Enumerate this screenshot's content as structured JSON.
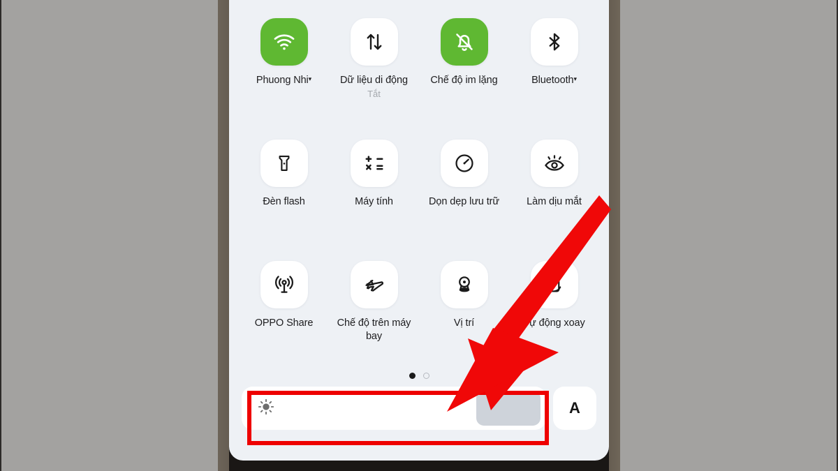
{
  "device": {
    "name": "phone-quick-settings",
    "panel_background": "#eef1f5",
    "accent_on_color": "#5fb832",
    "highlight_color": "#ee0000"
  },
  "quick_settings": {
    "tiles": [
      {
        "label": "Phuong Nhi",
        "caret": "▾",
        "sub": "",
        "state": "on",
        "icon": "wifi-icon"
      },
      {
        "label": "Dữ liệu di động",
        "caret": "",
        "sub": "Tắt",
        "state": "off",
        "icon": "mobile-data-icon"
      },
      {
        "label": "Chế độ im lặng",
        "caret": "",
        "sub": "",
        "state": "on",
        "icon": "bell-off-icon"
      },
      {
        "label": "Bluetooth",
        "caret": "▾",
        "sub": "",
        "state": "off",
        "icon": "bluetooth-icon"
      },
      {
        "label": "Đèn flash",
        "caret": "",
        "sub": "",
        "state": "off",
        "icon": "flashlight-icon"
      },
      {
        "label": "Máy tính",
        "caret": "",
        "sub": "",
        "state": "off",
        "icon": "calculator-icon"
      },
      {
        "label": "Dọn dẹp lưu trữ",
        "caret": "",
        "sub": "",
        "state": "off",
        "icon": "gauge-icon"
      },
      {
        "label": "Làm dịu mắt",
        "caret": "",
        "sub": "",
        "state": "off",
        "icon": "eye-comfort-icon"
      },
      {
        "label": "OPPO Share",
        "caret": "",
        "sub": "",
        "state": "off",
        "icon": "broadcast-icon"
      },
      {
        "label": "Chế độ trên máy bay",
        "caret": "",
        "sub": "",
        "state": "off",
        "icon": "airplane-icon"
      },
      {
        "label": "Vị trí",
        "caret": "",
        "sub": "",
        "state": "off",
        "icon": "location-pin-icon"
      },
      {
        "label": "Tự động xoay",
        "caret": "",
        "sub": "",
        "state": "off",
        "icon": "auto-rotate-icon"
      }
    ],
    "pages": {
      "count": 2,
      "current": 1
    }
  },
  "brightness": {
    "icon": "brightness-sun-icon",
    "slider_value_percent": 88,
    "auto_label": "A"
  },
  "annotations": {
    "arrow": {
      "name": "red-pointer-arrow",
      "points_to": "brightness-slider"
    },
    "box": {
      "name": "red-highlight-box",
      "surrounds": "brightness-slider"
    }
  }
}
